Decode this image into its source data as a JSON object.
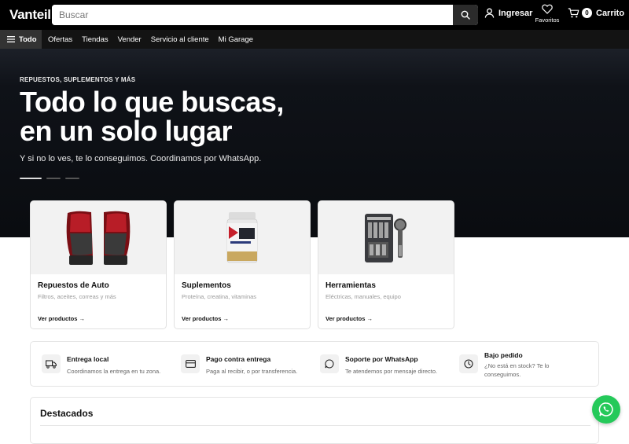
{
  "header": {
    "logo": "Vanteil",
    "search_placeholder": "Buscar",
    "login_label": "Ingresar",
    "favorites_label": "Favoritos",
    "cart_count": "0",
    "cart_label": "Carrito"
  },
  "nav": {
    "all_label": "Todo",
    "items": [
      "Ofertas",
      "Tiendas",
      "Vender",
      "Servicio al cliente",
      "Mi Garage"
    ]
  },
  "hero": {
    "kicker": "REPUESTOS, SUPLEMENTOS Y MÁS",
    "title_line1": "Todo lo que buscas,",
    "title_line2": "en un solo lugar",
    "subtitle": "Y si no lo ves, te lo conseguimos. Coordinamos por WhatsApp.",
    "slides": 3,
    "active_slide": 1
  },
  "categories": [
    {
      "name": "Repuestos de Auto",
      "desc": "Filtros, aceites, correas y más",
      "link": "Ver productos →",
      "image": "taillights"
    },
    {
      "name": "Suplementos",
      "desc": "Proteína, creatina, vitaminas",
      "link": "Ver productos →",
      "image": "protein-tub"
    },
    {
      "name": "Herramientas",
      "desc": "Eléctricas, manuales, equipo",
      "link": "Ver productos →",
      "image": "tool-set"
    }
  ],
  "features": [
    {
      "title": "Entrega local",
      "desc": "Coordinamos la entrega en tu zona.",
      "icon": "truck-icon"
    },
    {
      "title": "Pago contra entrega",
      "desc": "Paga al recibir, o por transferencia.",
      "icon": "card-icon"
    },
    {
      "title": "Soporte por WhatsApp",
      "desc": "Te atendemos por mensaje directo.",
      "icon": "chat-icon"
    },
    {
      "title": "Bajo pedido",
      "desc_line1": "¿No está en stock? Te lo",
      "desc_line2": "conseguimos.",
      "icon": "clock-icon"
    }
  ],
  "featured": {
    "title": "Destacados"
  },
  "colors": {
    "header_bg": "#000000",
    "nav_bg": "#131313",
    "hero_bg": "#0d1016",
    "whatsapp": "#25c95a"
  }
}
